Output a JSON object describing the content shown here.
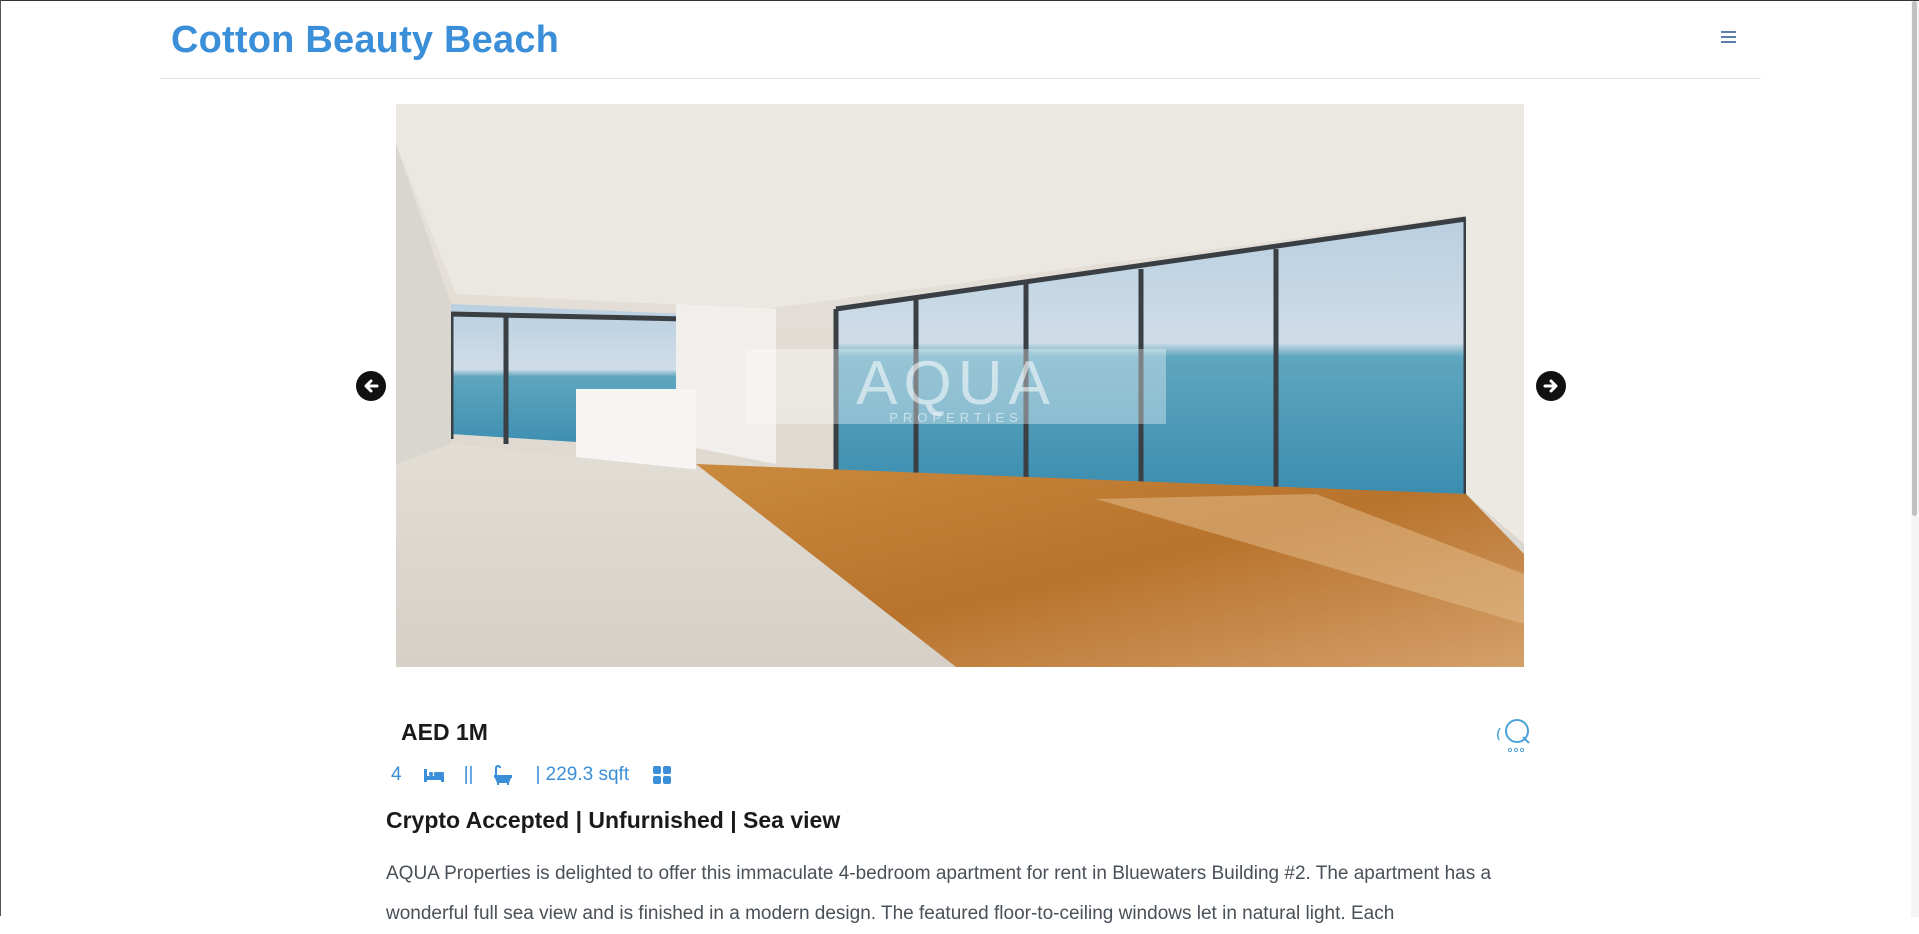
{
  "navbar": {
    "brand": "Cotton Beauty Beach",
    "menu_icon": "hamburger-icon"
  },
  "carousel": {
    "image_watermark": "AQUA",
    "image_watermark_sub": "PROPERTIES",
    "prev_icon": "arrow-left-circle-icon",
    "next_icon": "arrow-right-circle-icon"
  },
  "listing": {
    "price": "AED 1M",
    "bedrooms": "4",
    "separator": "||",
    "area": "| 229.3 sqft",
    "title": "Crypto Accepted | Unfurnished | Sea view",
    "description": "AQUA Properties is delighted to offer this immaculate 4-bedroom apartment for rent in Bluewaters Building #2. The apartment has a wonderful full sea view and is finished in a modern design. The featured floor-to-ceiling windows let in natural light. Each"
  },
  "colors": {
    "accent": "#3b8fd9",
    "text": "#1a1a1a",
    "muted": "#495057"
  }
}
